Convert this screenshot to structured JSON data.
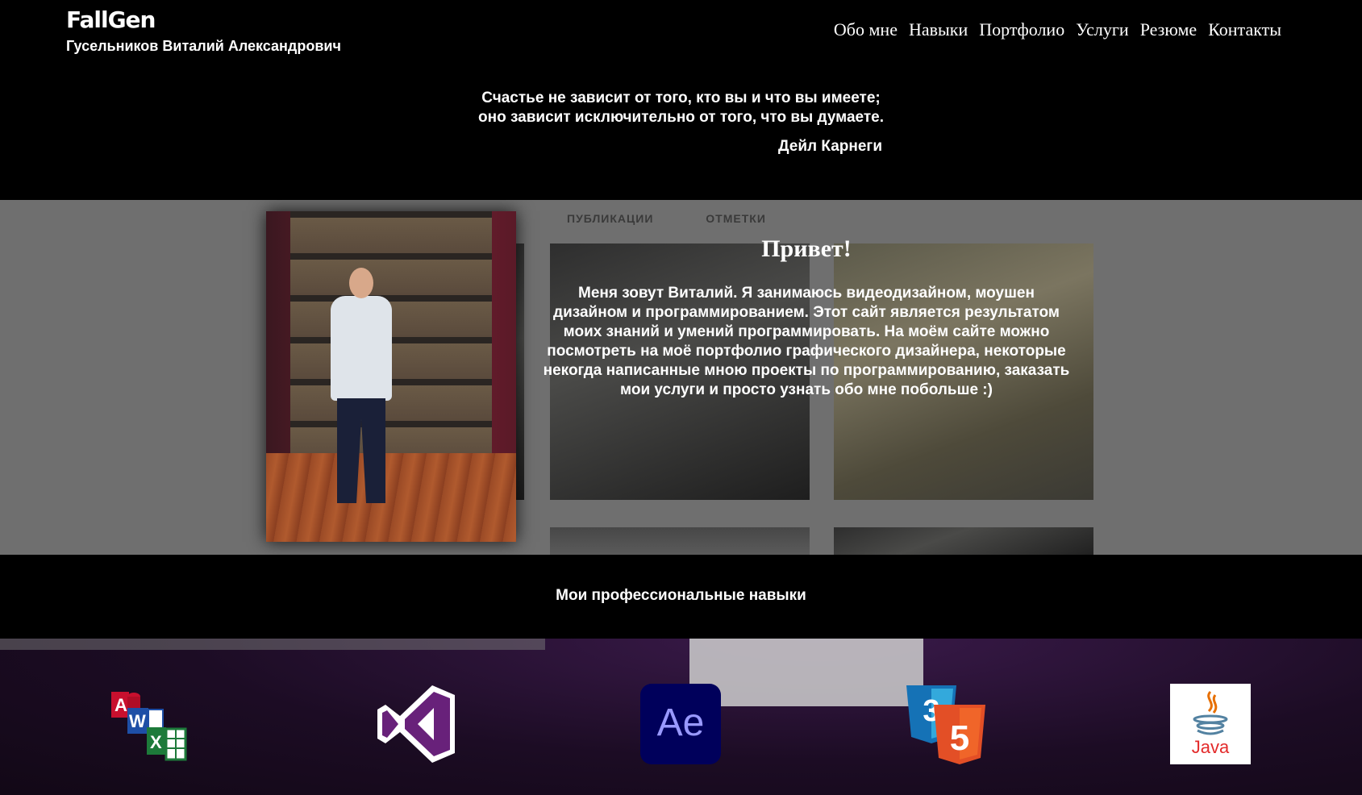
{
  "header": {
    "logo": "FallGen",
    "owner": "Гусельников Виталий Александрович",
    "nav": [
      "Обо мне",
      "Навыки",
      "Портфолио",
      "Услуги",
      "Резюме",
      "Контакты"
    ]
  },
  "quote": {
    "line1": "Счастье не зависит от того, кто вы и что вы имеете;",
    "line2": "оно зависит исключительно от того, что вы думаете.",
    "author": "Дейл Карнеги"
  },
  "hero": {
    "tabs": [
      "ПУБЛИКАЦИИ",
      "ОТМЕТКИ"
    ],
    "title": "Привет!",
    "text": "Меня зовут Виталий. Я занимаюсь видеодизайном, моушен дизайном и программированием. Этот сайт является результатом моих знаний и умений программировать. На моём сайте можно посмотреть на моё портфолио графического дизайнера, некоторые некогда написанные мною проекты по программированию, заказать мои услуги и просто узнать обо мне побольше :)"
  },
  "skills": {
    "title": "Мои профессиональные навыки",
    "icons": [
      "ms-office-icon",
      "visual-studio-icon",
      "after-effects-icon",
      "css3-html5-icon",
      "java-icon"
    ],
    "ae_label": "Ae",
    "java_label": "Java"
  },
  "colors": {
    "background": "#000000",
    "text": "#ffffff",
    "ae_bg": "#00005b",
    "ae_text": "#9999ff",
    "vs_purple": "#68217a",
    "html5": "#e34f26",
    "css3": "#1572b6"
  }
}
